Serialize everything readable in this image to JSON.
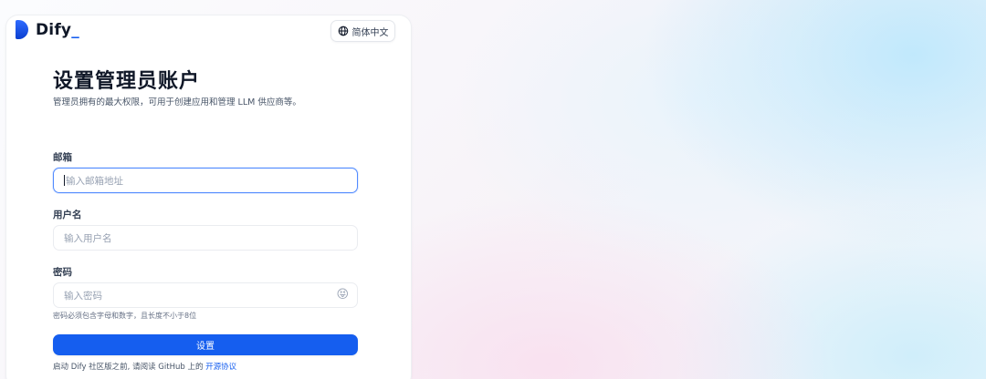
{
  "brand": {
    "name": "Dify",
    "name_suffix": "_"
  },
  "language": {
    "label": "简体中文",
    "icon": "globe-icon"
  },
  "page": {
    "title": "设置管理员账户",
    "subtitle": "管理员拥有的最大权限，可用于创建应用和管理 LLM 供应商等。"
  },
  "form": {
    "email": {
      "label": "邮箱",
      "placeholder": "输入邮箱地址",
      "value": ""
    },
    "username": {
      "label": "用户名",
      "placeholder": "输入用户名",
      "value": ""
    },
    "password": {
      "label": "密码",
      "placeholder": "输入密码",
      "value": "",
      "toggle_icon": "😝",
      "hint": "密码必须包含字母和数字，且长度不小于8位"
    },
    "submit_label": "设置"
  },
  "footer": {
    "agree_text": "启动 Dify 社区版之前, 请阅读 GitHub 上的",
    "link_text": "开源协议"
  },
  "colors": {
    "primary": "#155eef",
    "text": "#101828",
    "muted": "#475467"
  }
}
